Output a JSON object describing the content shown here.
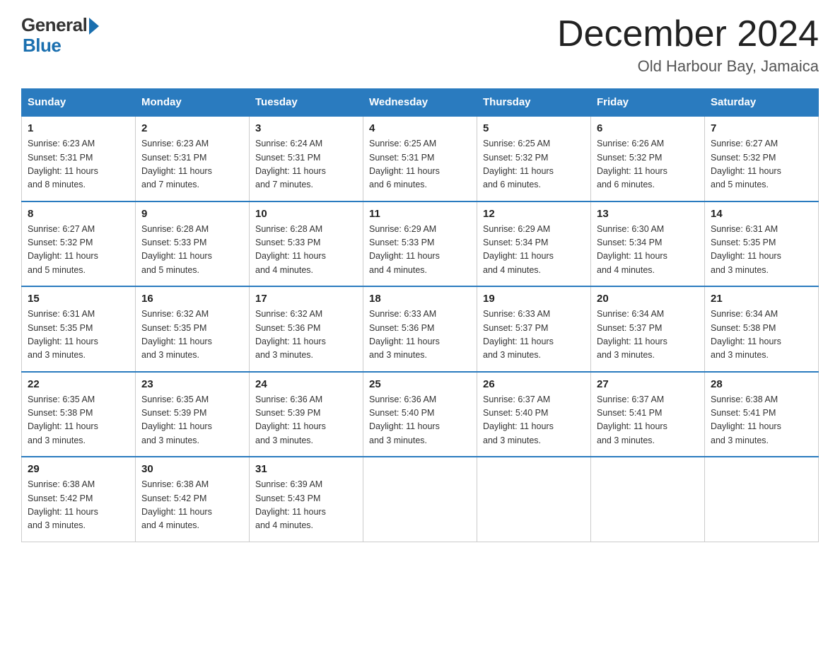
{
  "logo": {
    "general": "General",
    "blue": "Blue"
  },
  "header": {
    "title": "December 2024",
    "subtitle": "Old Harbour Bay, Jamaica"
  },
  "days_of_week": [
    "Sunday",
    "Monday",
    "Tuesday",
    "Wednesday",
    "Thursday",
    "Friday",
    "Saturday"
  ],
  "weeks": [
    [
      {
        "day": "1",
        "sunrise": "6:23 AM",
        "sunset": "5:31 PM",
        "daylight": "11 hours and 8 minutes."
      },
      {
        "day": "2",
        "sunrise": "6:23 AM",
        "sunset": "5:31 PM",
        "daylight": "11 hours and 7 minutes."
      },
      {
        "day": "3",
        "sunrise": "6:24 AM",
        "sunset": "5:31 PM",
        "daylight": "11 hours and 7 minutes."
      },
      {
        "day": "4",
        "sunrise": "6:25 AM",
        "sunset": "5:31 PM",
        "daylight": "11 hours and 6 minutes."
      },
      {
        "day": "5",
        "sunrise": "6:25 AM",
        "sunset": "5:32 PM",
        "daylight": "11 hours and 6 minutes."
      },
      {
        "day": "6",
        "sunrise": "6:26 AM",
        "sunset": "5:32 PM",
        "daylight": "11 hours and 6 minutes."
      },
      {
        "day": "7",
        "sunrise": "6:27 AM",
        "sunset": "5:32 PM",
        "daylight": "11 hours and 5 minutes."
      }
    ],
    [
      {
        "day": "8",
        "sunrise": "6:27 AM",
        "sunset": "5:32 PM",
        "daylight": "11 hours and 5 minutes."
      },
      {
        "day": "9",
        "sunrise": "6:28 AM",
        "sunset": "5:33 PM",
        "daylight": "11 hours and 5 minutes."
      },
      {
        "day": "10",
        "sunrise": "6:28 AM",
        "sunset": "5:33 PM",
        "daylight": "11 hours and 4 minutes."
      },
      {
        "day": "11",
        "sunrise": "6:29 AM",
        "sunset": "5:33 PM",
        "daylight": "11 hours and 4 minutes."
      },
      {
        "day": "12",
        "sunrise": "6:29 AM",
        "sunset": "5:34 PM",
        "daylight": "11 hours and 4 minutes."
      },
      {
        "day": "13",
        "sunrise": "6:30 AM",
        "sunset": "5:34 PM",
        "daylight": "11 hours and 4 minutes."
      },
      {
        "day": "14",
        "sunrise": "6:31 AM",
        "sunset": "5:35 PM",
        "daylight": "11 hours and 3 minutes."
      }
    ],
    [
      {
        "day": "15",
        "sunrise": "6:31 AM",
        "sunset": "5:35 PM",
        "daylight": "11 hours and 3 minutes."
      },
      {
        "day": "16",
        "sunrise": "6:32 AM",
        "sunset": "5:35 PM",
        "daylight": "11 hours and 3 minutes."
      },
      {
        "day": "17",
        "sunrise": "6:32 AM",
        "sunset": "5:36 PM",
        "daylight": "11 hours and 3 minutes."
      },
      {
        "day": "18",
        "sunrise": "6:33 AM",
        "sunset": "5:36 PM",
        "daylight": "11 hours and 3 minutes."
      },
      {
        "day": "19",
        "sunrise": "6:33 AM",
        "sunset": "5:37 PM",
        "daylight": "11 hours and 3 minutes."
      },
      {
        "day": "20",
        "sunrise": "6:34 AM",
        "sunset": "5:37 PM",
        "daylight": "11 hours and 3 minutes."
      },
      {
        "day": "21",
        "sunrise": "6:34 AM",
        "sunset": "5:38 PM",
        "daylight": "11 hours and 3 minutes."
      }
    ],
    [
      {
        "day": "22",
        "sunrise": "6:35 AM",
        "sunset": "5:38 PM",
        "daylight": "11 hours and 3 minutes."
      },
      {
        "day": "23",
        "sunrise": "6:35 AM",
        "sunset": "5:39 PM",
        "daylight": "11 hours and 3 minutes."
      },
      {
        "day": "24",
        "sunrise": "6:36 AM",
        "sunset": "5:39 PM",
        "daylight": "11 hours and 3 minutes."
      },
      {
        "day": "25",
        "sunrise": "6:36 AM",
        "sunset": "5:40 PM",
        "daylight": "11 hours and 3 minutes."
      },
      {
        "day": "26",
        "sunrise": "6:37 AM",
        "sunset": "5:40 PM",
        "daylight": "11 hours and 3 minutes."
      },
      {
        "day": "27",
        "sunrise": "6:37 AM",
        "sunset": "5:41 PM",
        "daylight": "11 hours and 3 minutes."
      },
      {
        "day": "28",
        "sunrise": "6:38 AM",
        "sunset": "5:41 PM",
        "daylight": "11 hours and 3 minutes."
      }
    ],
    [
      {
        "day": "29",
        "sunrise": "6:38 AM",
        "sunset": "5:42 PM",
        "daylight": "11 hours and 3 minutes."
      },
      {
        "day": "30",
        "sunrise": "6:38 AM",
        "sunset": "5:42 PM",
        "daylight": "11 hours and 4 minutes."
      },
      {
        "day": "31",
        "sunrise": "6:39 AM",
        "sunset": "5:43 PM",
        "daylight": "11 hours and 4 minutes."
      },
      null,
      null,
      null,
      null
    ]
  ],
  "labels": {
    "sunrise": "Sunrise:",
    "sunset": "Sunset:",
    "daylight": "Daylight:"
  }
}
